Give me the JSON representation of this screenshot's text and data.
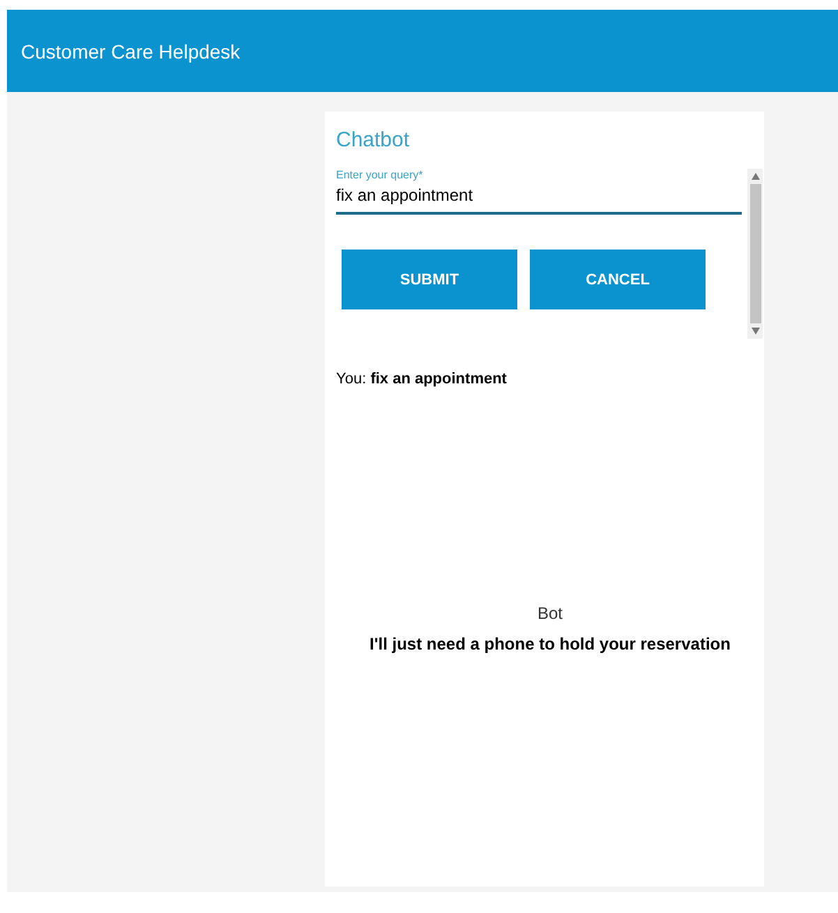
{
  "header": {
    "title": "Customer Care Helpdesk"
  },
  "chatbot": {
    "title": "Chatbot",
    "query": {
      "label": "Enter your query",
      "required_mark": "*",
      "value": "fix an appointment"
    },
    "buttons": [
      "SUBMIT",
      "CANCEL"
    ],
    "user_message": "You: **fix an appointment**",
    "bot_label": "Bot",
    "bot_message": "I'll just need a phone to hold your reservation"
  }
}
